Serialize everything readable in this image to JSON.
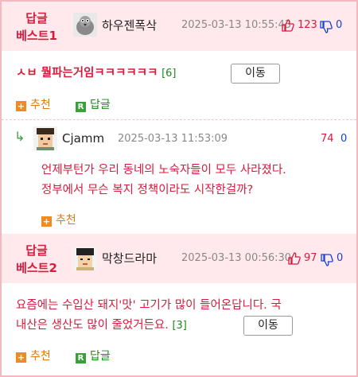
{
  "comments": [
    {
      "best_label_1": "답글",
      "best_label_2": "베스트1",
      "nickname": "하우젠폭삭",
      "timestamp": "2025-03-13 10:55:43",
      "up": "123",
      "down": "0",
      "text": "ㅅㅂ 뭘파는거임ㅋㅋㅋㅋㅋㅋ",
      "reply_count": "[6]",
      "move_label": "이동",
      "recommend_label": "추천",
      "reply_label": "답글"
    },
    {
      "reply_arrow": "↳",
      "nickname": "Cjamm",
      "timestamp": "2025-03-13 11:53:09",
      "up": "74",
      "down": "0",
      "text_line1": "언제부턴가 우리 동네의 노숙자들이 모두 사라졌다.",
      "text_line2": "정부에서 무슨 복지 정책이라도 시작한걸까?",
      "recommend_label": "추천"
    },
    {
      "best_label_1": "답글",
      "best_label_2": "베스트2",
      "nickname": "막창드라마",
      "timestamp": "2025-03-13 00:56:30",
      "up": "97",
      "down": "0",
      "text_line1": "요즘에는 수입산 돼지'맛' 고기가 많이 들어온답니다. 국",
      "text_line2": "내산은 생산도 많이 줄었거든요.",
      "reply_count": "[3]",
      "move_label": "이동",
      "recommend_label": "추천",
      "reply_label": "답글"
    }
  ],
  "colors": {
    "best_bg": "#ffe9ec",
    "border": "#f3b9c0",
    "red_text": "#d81b3c",
    "blue": "#1a3fd6",
    "green": "#1b8a1b",
    "orange": "#e07a10"
  },
  "icons": [
    "avatar-pigeon",
    "avatar-pixel-face",
    "thumb-up-icon",
    "thumb-down-icon",
    "plus-icon",
    "reply-r-icon",
    "reply-arrow-icon"
  ]
}
